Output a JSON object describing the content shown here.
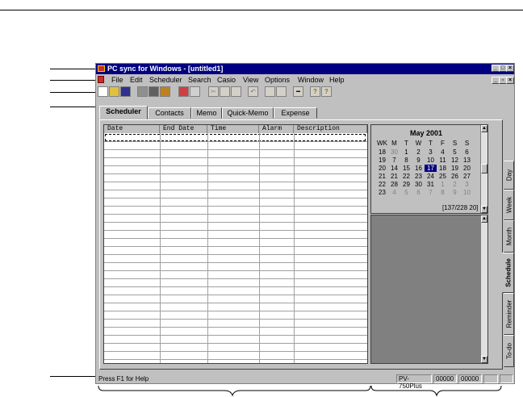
{
  "window": {
    "title": "PC sync for Windows - [untitled1]",
    "controls": [
      "_",
      "□",
      "×"
    ],
    "mdi_controls": [
      "_",
      "▫",
      "×"
    ]
  },
  "menu": [
    "File",
    "Edit",
    "Scheduler",
    "Search",
    "Casio",
    "View",
    "Options",
    "Window",
    "Help"
  ],
  "toolbar_icons": [
    "new-icon",
    "open-icon",
    "save-icon",
    "print-icon",
    "print-preview-icon",
    "export-icon",
    "import-icon",
    "link-icon",
    "cut-icon",
    "copy-icon",
    "paste-icon",
    "undo-icon",
    "find-icon",
    "replace-icon",
    "key-icon",
    "help-icon",
    "context-help-icon"
  ],
  "tabs": [
    {
      "label": "Scheduler",
      "active": true
    },
    {
      "label": "Contacts",
      "active": false
    },
    {
      "label": "Memo",
      "active": false
    },
    {
      "label": "Quick-Memo",
      "active": false
    },
    {
      "label": "Expense",
      "active": false
    }
  ],
  "grid": {
    "columns": [
      "Date",
      "End Date",
      "Time",
      "Alarm",
      "Description"
    ]
  },
  "calendar": {
    "title": "May 2001",
    "headers": [
      "WK",
      "M",
      "T",
      "W",
      "T",
      "F",
      "S",
      "S"
    ],
    "weeks": [
      [
        "18",
        "30",
        "1",
        "2",
        "3",
        "4",
        "5",
        "6"
      ],
      [
        "19",
        "7",
        "8",
        "9",
        "10",
        "11",
        "12",
        "13"
      ],
      [
        "20",
        "14",
        "15",
        "16",
        "17",
        "18",
        "19",
        "20"
      ],
      [
        "21",
        "21",
        "22",
        "23",
        "24",
        "25",
        "26",
        "27"
      ],
      [
        "22",
        "28",
        "29",
        "30",
        "31",
        "1",
        "2",
        "3"
      ],
      [
        "23",
        "4",
        "5",
        "6",
        "7",
        "8",
        "9",
        "10"
      ]
    ],
    "selected_day": "17",
    "day_counter": "[137/228 20]"
  },
  "side_tabs": [
    {
      "label": "Day",
      "active": false
    },
    {
      "label": "Week",
      "active": false
    },
    {
      "label": "Month",
      "active": false
    },
    {
      "label": "Schedule",
      "active": true
    },
    {
      "label": "Reminder",
      "active": false
    },
    {
      "label": "To-do",
      "active": false
    }
  ],
  "status": {
    "help": "Press F1 for Help",
    "model": "PV-750Plus",
    "counter1": "00000",
    "counter2": "00000"
  }
}
